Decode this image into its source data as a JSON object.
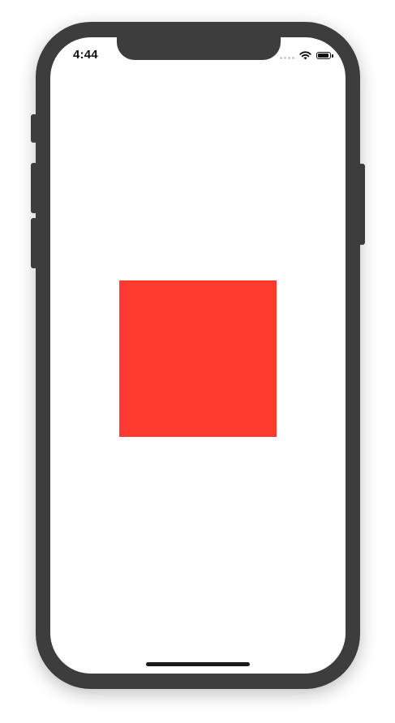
{
  "status_bar": {
    "time": "4:44",
    "icons": [
      "cellular-signal-icon",
      "wifi-icon",
      "battery-icon"
    ],
    "battery_level": 0.9
  },
  "content": {
    "square_color": "#ff3b30"
  },
  "device": {
    "frame_color": "#3d3d3d",
    "screen_color": "#ffffff"
  }
}
